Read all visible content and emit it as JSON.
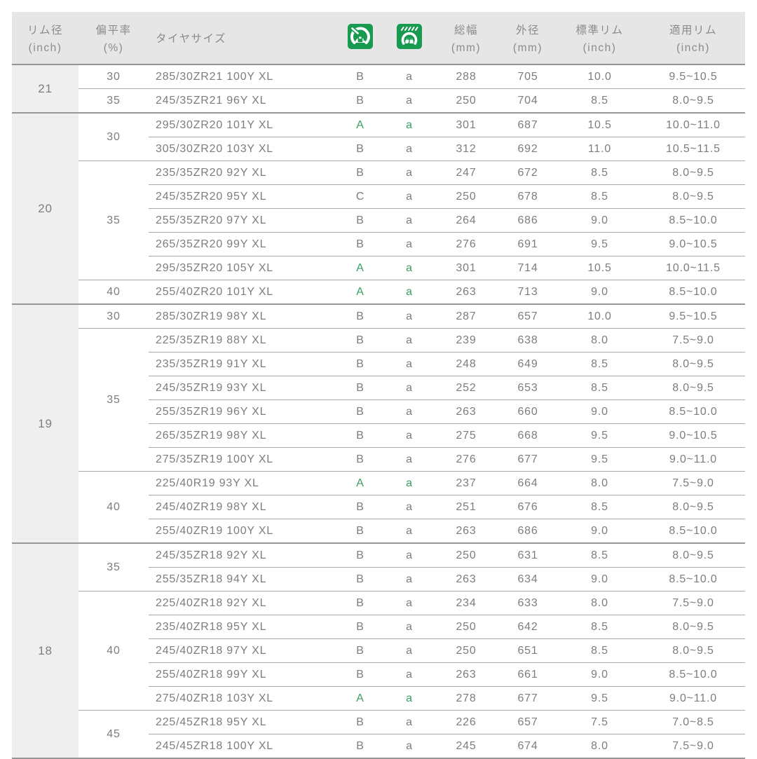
{
  "table": {
    "headers": {
      "rim": {
        "label": "リム径",
        "unit": "(inch)"
      },
      "aspect": {
        "label": "偏平率",
        "unit": "(%)"
      },
      "size": {
        "label": "タイヤサイズ"
      },
      "fuel_icon_name": "fuel-efficiency-label-icon",
      "wet_icon_name": "wet-grip-label-icon",
      "width": {
        "label": "総幅",
        "unit": "(mm)"
      },
      "diameter": {
        "label": "外径",
        "unit": "(mm)"
      },
      "std_rim": {
        "label": "標準リム",
        "unit": "(inch)"
      },
      "app_rim": {
        "label": "適用リム",
        "unit": "(inch)"
      }
    },
    "colors": {
      "accent_green": "#3a9e62",
      "icon_green": "#189a50",
      "header_bg": "#e6e6e6",
      "rim_col_bg": "#efefef",
      "text_gray": "#7d7d7d",
      "section_line": "#979797",
      "row_line": "#a8a8a8"
    },
    "sections": [
      {
        "rim": "21",
        "groups": [
          {
            "aspect": "30",
            "rows": [
              {
                "size": "285/30ZR21 100Y XL",
                "fuel": "B",
                "wet": "a",
                "width": "288",
                "diameter": "705",
                "std_rim": "10.0",
                "app_rim": "9.5~10.5"
              }
            ]
          },
          {
            "aspect": "35",
            "rows": [
              {
                "size": "245/35ZR21 96Y XL",
                "fuel": "B",
                "wet": "a",
                "width": "250",
                "diameter": "704",
                "std_rim": "8.5",
                "app_rim": "8.0~9.5"
              }
            ]
          }
        ]
      },
      {
        "rim": "20",
        "groups": [
          {
            "aspect": "30",
            "rows": [
              {
                "size": "295/30ZR20 101Y XL",
                "fuel": "A",
                "wet": "a",
                "accent": true,
                "width": "301",
                "diameter": "687",
                "std_rim": "10.5",
                "app_rim": "10.0~11.0"
              },
              {
                "size": "305/30ZR20 103Y XL",
                "fuel": "B",
                "wet": "a",
                "width": "312",
                "diameter": "692",
                "std_rim": "11.0",
                "app_rim": "10.5~11.5"
              }
            ]
          },
          {
            "aspect": "35",
            "rows": [
              {
                "size": "235/35ZR20 92Y XL",
                "fuel": "B",
                "wet": "a",
                "width": "247",
                "diameter": "672",
                "std_rim": "8.5",
                "app_rim": "8.0~9.5"
              },
              {
                "size": "245/35ZR20 95Y XL",
                "fuel": "C",
                "wet": "a",
                "width": "250",
                "diameter": "678",
                "std_rim": "8.5",
                "app_rim": "8.0~9.5"
              },
              {
                "size": "255/35ZR20 97Y XL",
                "fuel": "B",
                "wet": "a",
                "width": "264",
                "diameter": "686",
                "std_rim": "9.0",
                "app_rim": "8.5~10.0"
              },
              {
                "size": "265/35ZR20 99Y XL",
                "fuel": "B",
                "wet": "a",
                "width": "276",
                "diameter": "691",
                "std_rim": "9.5",
                "app_rim": "9.0~10.5"
              },
              {
                "size": "295/35ZR20 105Y XL",
                "fuel": "A",
                "wet": "a",
                "accent": true,
                "width": "301",
                "diameter": "714",
                "std_rim": "10.5",
                "app_rim": "10.0~11.5"
              }
            ]
          },
          {
            "aspect": "40",
            "rows": [
              {
                "size": "255/40ZR20 101Y XL",
                "fuel": "A",
                "wet": "a",
                "accent": true,
                "width": "263",
                "diameter": "713",
                "std_rim": "9.0",
                "app_rim": "8.5~10.0"
              }
            ]
          }
        ]
      },
      {
        "rim": "19",
        "groups": [
          {
            "aspect": "30",
            "rows": [
              {
                "size": "285/30ZR19 98Y XL",
                "fuel": "B",
                "wet": "a",
                "width": "287",
                "diameter": "657",
                "std_rim": "10.0",
                "app_rim": "9.5~10.5"
              }
            ]
          },
          {
            "aspect": "35",
            "rows": [
              {
                "size": "225/35ZR19 88Y XL",
                "fuel": "B",
                "wet": "a",
                "width": "239",
                "diameter": "638",
                "std_rim": "8.0",
                "app_rim": "7.5~9.0"
              },
              {
                "size": "235/35ZR19 91Y XL",
                "fuel": "B",
                "wet": "a",
                "width": "248",
                "diameter": "649",
                "std_rim": "8.5",
                "app_rim": "8.0~9.5"
              },
              {
                "size": "245/35ZR19 93Y XL",
                "fuel": "B",
                "wet": "a",
                "width": "252",
                "diameter": "653",
                "std_rim": "8.5",
                "app_rim": "8.0~9.5"
              },
              {
                "size": "255/35ZR19 96Y XL",
                "fuel": "B",
                "wet": "a",
                "width": "263",
                "diameter": "660",
                "std_rim": "9.0",
                "app_rim": "8.5~10.0"
              },
              {
                "size": "265/35ZR19 98Y XL",
                "fuel": "B",
                "wet": "a",
                "width": "275",
                "diameter": "668",
                "std_rim": "9.5",
                "app_rim": "9.0~10.5"
              },
              {
                "size": "275/35ZR19 100Y XL",
                "fuel": "B",
                "wet": "a",
                "width": "276",
                "diameter": "677",
                "std_rim": "9.5",
                "app_rim": "9.0~11.0"
              }
            ]
          },
          {
            "aspect": "40",
            "rows": [
              {
                "size": "225/40R19 93Y XL",
                "fuel": "A",
                "wet": "a",
                "accent": true,
                "width": "237",
                "diameter": "664",
                "std_rim": "8.0",
                "app_rim": "7.5~9.0"
              },
              {
                "size": "245/40ZR19 98Y XL",
                "fuel": "B",
                "wet": "a",
                "width": "251",
                "diameter": "676",
                "std_rim": "8.5",
                "app_rim": "8.0~9.5"
              },
              {
                "size": "255/40ZR19 100Y XL",
                "fuel": "B",
                "wet": "a",
                "width": "263",
                "diameter": "686",
                "std_rim": "9.0",
                "app_rim": "8.5~10.0"
              }
            ]
          }
        ]
      },
      {
        "rim": "18",
        "groups": [
          {
            "aspect": "35",
            "rows": [
              {
                "size": "245/35ZR18 92Y XL",
                "fuel": "B",
                "wet": "a",
                "width": "250",
                "diameter": "631",
                "std_rim": "8.5",
                "app_rim": "8.0~9.5"
              },
              {
                "size": "255/35ZR18 94Y XL",
                "fuel": "B",
                "wet": "a",
                "width": "263",
                "diameter": "634",
                "std_rim": "9.0",
                "app_rim": "8.5~10.0"
              }
            ]
          },
          {
            "aspect": "40",
            "rows": [
              {
                "size": "225/40ZR18 92Y XL",
                "fuel": "B",
                "wet": "a",
                "width": "234",
                "diameter": "633",
                "std_rim": "8.0",
                "app_rim": "7.5~9.0"
              },
              {
                "size": "235/40ZR18 95Y XL",
                "fuel": "B",
                "wet": "a",
                "width": "250",
                "diameter": "642",
                "std_rim": "8.5",
                "app_rim": "8.0~9.5"
              },
              {
                "size": "245/40ZR18 97Y XL",
                "fuel": "B",
                "wet": "a",
                "width": "250",
                "diameter": "651",
                "std_rim": "8.5",
                "app_rim": "8.0~9.5"
              },
              {
                "size": "255/40ZR18 99Y XL",
                "fuel": "B",
                "wet": "a",
                "width": "263",
                "diameter": "661",
                "std_rim": "9.0",
                "app_rim": "8.5~10.0"
              },
              {
                "size": "275/40ZR18 103Y XL",
                "fuel": "A",
                "wet": "a",
                "accent": true,
                "width": "278",
                "diameter": "677",
                "std_rim": "9.5",
                "app_rim": "9.0~11.0"
              }
            ]
          },
          {
            "aspect": "45",
            "rows": [
              {
                "size": "225/45ZR18 95Y XL",
                "fuel": "B",
                "wet": "a",
                "width": "226",
                "diameter": "657",
                "std_rim": "7.5",
                "app_rim": "7.0~8.5"
              },
              {
                "size": "245/45ZR18 100Y XL",
                "fuel": "B",
                "wet": "a",
                "width": "245",
                "diameter": "674",
                "std_rim": "8.0",
                "app_rim": "7.5~9.0"
              }
            ]
          }
        ]
      }
    ]
  }
}
